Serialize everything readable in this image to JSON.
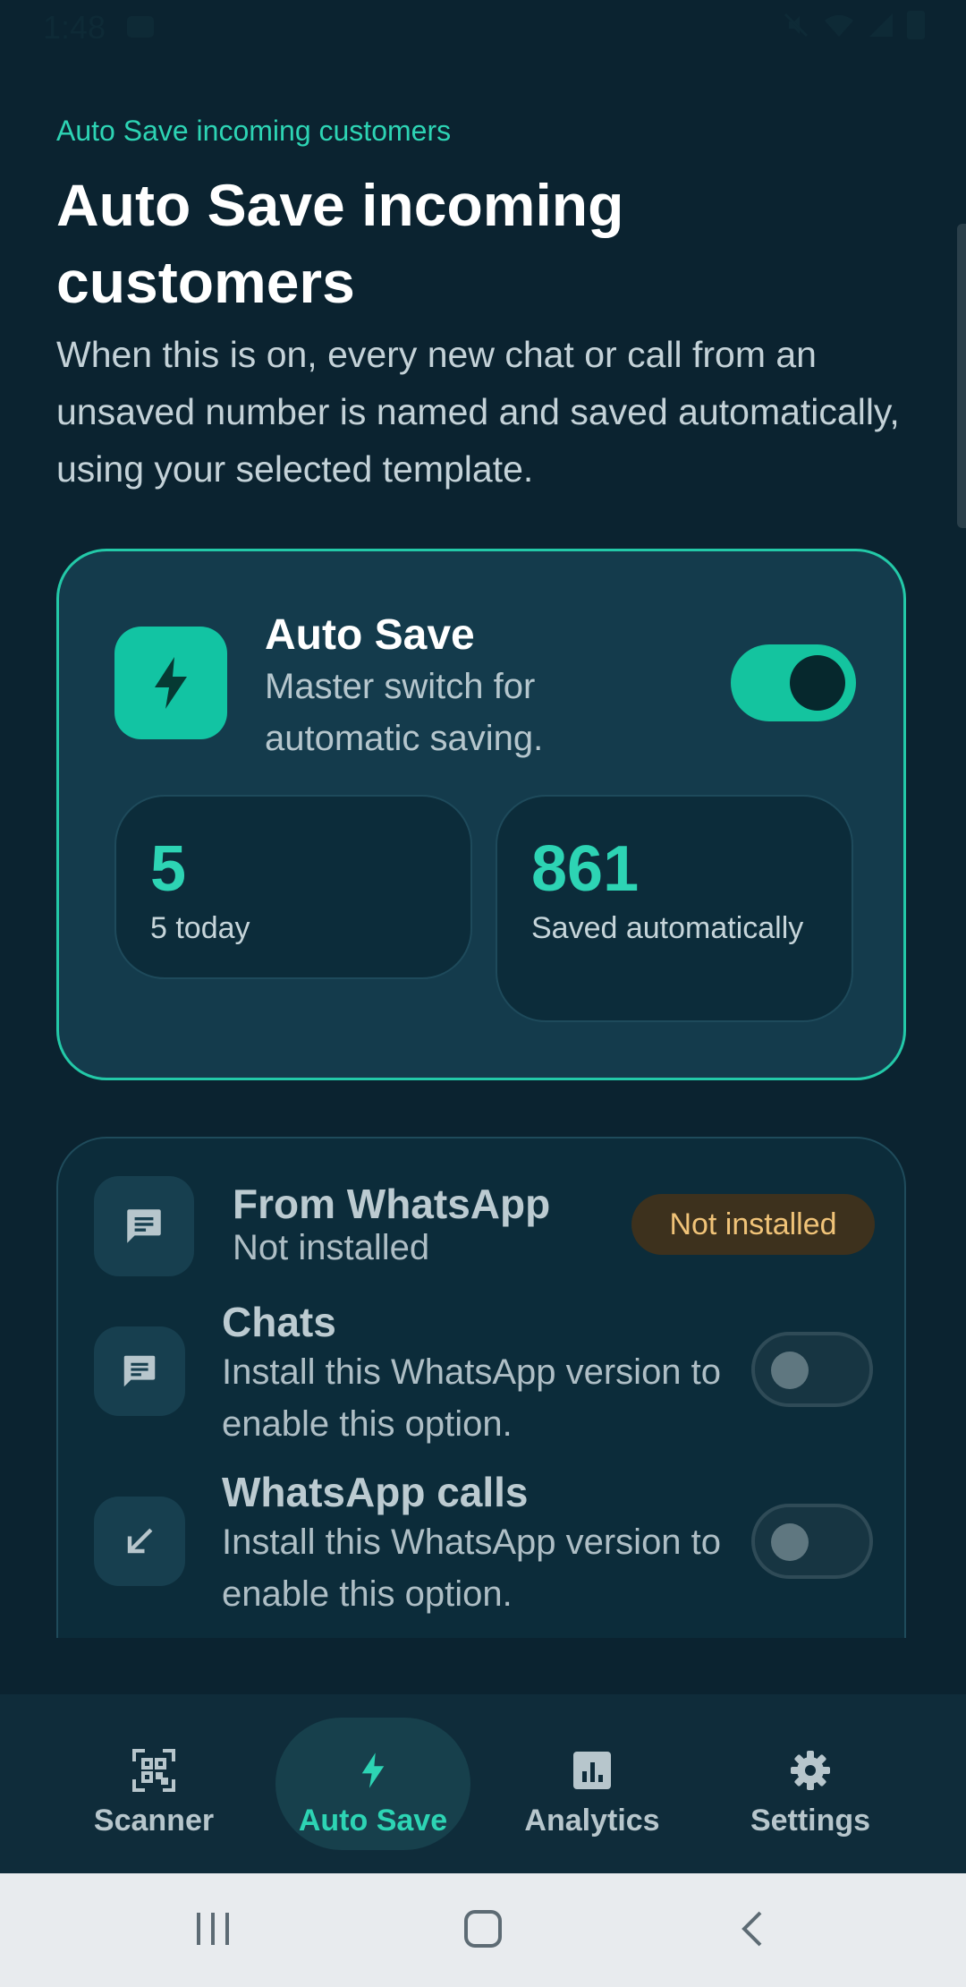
{
  "status_bar": {
    "time": "1:48"
  },
  "header": {
    "overline": "Auto Save incoming customers",
    "title": "Auto Save incoming customers",
    "description": "When this is on, every new chat or call from an unsaved number is named and saved automatically, using your selected template."
  },
  "master": {
    "icon": "bolt-icon",
    "title": "Auto Save",
    "subtitle": "Master switch for automatic saving.",
    "enabled": true,
    "stats": [
      {
        "value": "5",
        "label": "5 today"
      },
      {
        "value": "861",
        "label": "Saved automatically"
      }
    ]
  },
  "whatsapp": {
    "icon": "chat-icon",
    "title": "From WhatsApp",
    "subtitle": "Not installed",
    "badge": "Not installed",
    "options": [
      {
        "icon": "chat-icon",
        "title": "Chats",
        "subtitle": "Install this WhatsApp version to enable this option.",
        "enabled": false
      },
      {
        "icon": "incoming-call-arrow-icon",
        "title": "WhatsApp calls",
        "subtitle": "Install this WhatsApp version to enable this option.",
        "enabled": false
      }
    ]
  },
  "bottom_nav": {
    "items": [
      {
        "label": "Scanner",
        "icon": "qr-scanner-icon",
        "active": false
      },
      {
        "label": "Auto Save",
        "icon": "bolt-icon",
        "active": true
      },
      {
        "label": "Analytics",
        "icon": "analytics-icon",
        "active": false
      },
      {
        "label": "Settings",
        "icon": "gear-icon",
        "active": false
      }
    ]
  },
  "colors": {
    "background": "#0b2330",
    "accent": "#2dd4b4",
    "card": "#143b4c",
    "badge_bg": "#3d311d",
    "badge_text": "#f0c378"
  }
}
